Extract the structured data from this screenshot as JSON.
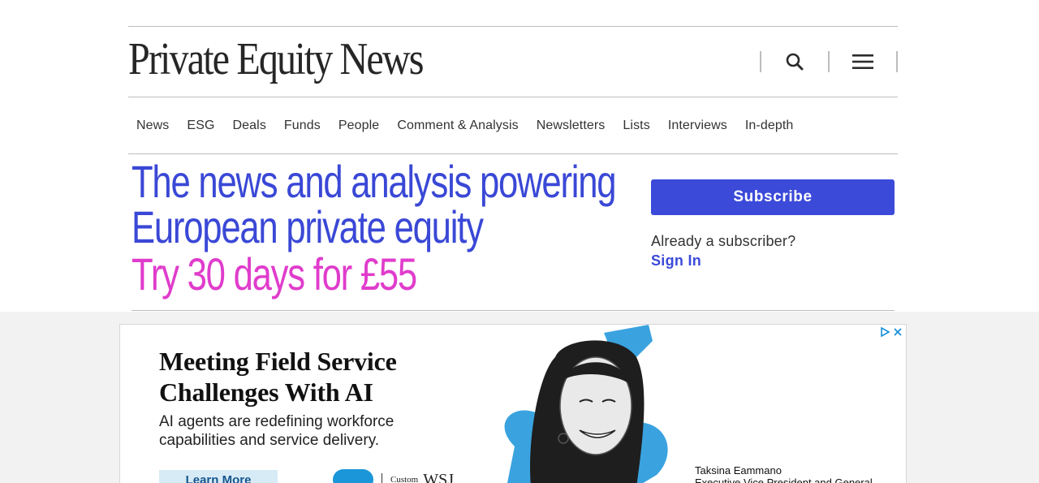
{
  "site": {
    "logo_text": "Private Equity News",
    "search_label": "search",
    "menu_label": "menu"
  },
  "nav": {
    "items": [
      "News",
      "ESG",
      "Deals",
      "Funds",
      "People",
      "Comment & Analysis",
      "Newsletters",
      "Lists",
      "Interviews",
      "In-depth"
    ]
  },
  "hero": {
    "line1": "The news and analysis powering",
    "line2": "European private equity",
    "offer": "Try 30 days for £55"
  },
  "subscribe": {
    "button_label": "Subscribe",
    "already_text": "Already a subscriber?",
    "signin_label": "Sign In"
  },
  "ad": {
    "headline": "Meeting Field Service Challenges With AI",
    "body": "AI agents are redefining workforce capabilities and service delivery.",
    "cta": "Learn More",
    "custom_label": "Custom",
    "wsj_label": "WSJ",
    "person_name": "Taksina Eammano",
    "person_title": "Executive Vice President and General"
  },
  "colors": {
    "brand_blue": "#3b4ad9",
    "offer_pink": "#e03ccc",
    "rule_gray": "#bdbdbd"
  },
  "icons": [
    "search-icon",
    "hamburger-menu-icon",
    "ad-choices-icon",
    "ad-close-icon"
  ]
}
